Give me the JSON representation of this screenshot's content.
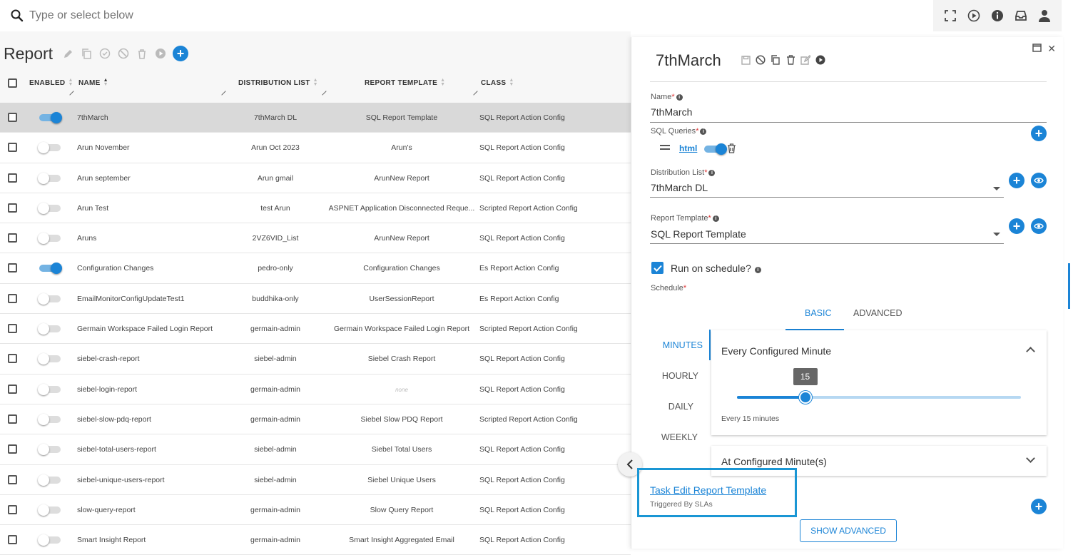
{
  "search": {
    "placeholder": "Type or select below"
  },
  "topbar_icons": [
    "fullscreen-icon",
    "play-circle-icon",
    "info-icon",
    "inbox-icon",
    "user-icon"
  ],
  "page": {
    "title": "Report"
  },
  "columns": {
    "enabled": "ENABLED",
    "name": "NAME",
    "distribution_list": "DISTRIBUTION LIST",
    "report_template": "REPORT TEMPLATE",
    "class": "CLASS"
  },
  "rows": [
    {
      "enabled": true,
      "name": "7thMarch",
      "dl": "7thMarch DL",
      "template": "SQL Report Template",
      "class": "SQL Report Action Config",
      "selected": true
    },
    {
      "enabled": false,
      "name": "Arun November",
      "dl": "Arun Oct 2023",
      "template": "Arun's",
      "class": "SQL Report Action Config"
    },
    {
      "enabled": false,
      "name": "Arun september",
      "dl": "Arun gmail",
      "template": "ArunNew Report",
      "class": "SQL Report Action Config"
    },
    {
      "enabled": false,
      "name": "Arun Test",
      "dl": "test Arun",
      "template": "ASPNET Application Disconnected Reque...",
      "class": "Scripted Report Action Config"
    },
    {
      "enabled": false,
      "name": "Aruns",
      "dl": "2VZ6VID_List",
      "template": "ArunNew Report",
      "class": "SQL Report Action Config"
    },
    {
      "enabled": true,
      "name": "Configuration Changes",
      "dl": "pedro-only",
      "template": "Configuration Changes",
      "class": "Es Report Action Config"
    },
    {
      "enabled": false,
      "name": "EmailMonitorConfigUpdateTest1",
      "dl": "buddhika-only",
      "template": "UserSessionReport",
      "class": "Es Report Action Config"
    },
    {
      "enabled": false,
      "name": "Germain Workspace Failed Login Report",
      "dl": "germain-admin",
      "template": "Germain Workspace Failed Login Report",
      "class": "Scripted Report Action Config"
    },
    {
      "enabled": false,
      "name": "siebel-crash-report",
      "dl": "siebel-admin",
      "template": "Siebel Crash Report",
      "class": "SQL Report Action Config"
    },
    {
      "enabled": false,
      "name": "siebel-login-report",
      "dl": "germain-admin",
      "template": "none",
      "class": "SQL Report Action Config",
      "template_none": true
    },
    {
      "enabled": false,
      "name": "siebel-slow-pdq-report",
      "dl": "germain-admin",
      "template": "Siebel Slow PDQ Report",
      "class": "Scripted Report Action Config"
    },
    {
      "enabled": false,
      "name": "siebel-total-users-report",
      "dl": "siebel-admin",
      "template": "Siebel Total Users",
      "class": "SQL Report Action Config"
    },
    {
      "enabled": false,
      "name": "siebel-unique-users-report",
      "dl": "siebel-admin",
      "template": "Siebel Unique Users",
      "class": "SQL Report Action Config"
    },
    {
      "enabled": false,
      "name": "slow-query-report",
      "dl": "germain-admin",
      "template": "Slow Query Report",
      "class": "SQL Report Action Config"
    },
    {
      "enabled": false,
      "name": "Smart Insight Report",
      "dl": "germain-admin",
      "template": "Smart Insight Aggregated Email",
      "class": "SQL Report Action Config"
    }
  ],
  "panel": {
    "title": "7thMarch",
    "name_label": "Name",
    "name_value": "7thMarch",
    "sql_queries_label": "SQL Queries",
    "sql_query_link": "html",
    "sql_query_enabled": true,
    "distribution_list_label": "Distribution List",
    "distribution_list_value": "7thMarch DL",
    "report_template_label": "Report Template",
    "report_template_value": "SQL Report Template",
    "run_on_schedule_label": "Run on schedule?",
    "run_on_schedule_checked": true,
    "schedule_label": "Schedule",
    "tabs": [
      "BASIC",
      "ADVANCED"
    ],
    "active_tab": "BASIC",
    "vtabs": [
      "MINUTES",
      "HOURLY",
      "DAILY",
      "WEEKLY"
    ],
    "active_vtab": "MINUTES",
    "every_minute_title": "Every Configured Minute",
    "slider_value": "15",
    "slider_fraction": 0.24,
    "every_text": "Every 15 minutes",
    "at_minute_title": "At Configured Minute(s)",
    "task_link": "Task Edit Report Template",
    "task_sub": "Triggered By SLAs",
    "show_advanced": "SHOW ADVANCED"
  },
  "colors": {
    "accent": "#1b84d6",
    "highlight": "#1a96d4",
    "selected_row": "#d9d9d9"
  }
}
